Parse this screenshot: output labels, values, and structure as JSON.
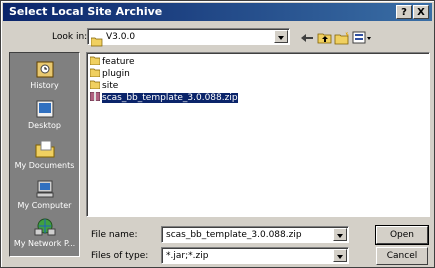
{
  "dialog": {
    "title": "Select Local Site Archive",
    "help_label": "?",
    "close_label": "X"
  },
  "lookin": {
    "label": "Look in:",
    "value": "V3.0.0"
  },
  "places": [
    {
      "label": "History",
      "icon": "history-icon"
    },
    {
      "label": "Desktop",
      "icon": "desktop-icon"
    },
    {
      "label": "My Documents",
      "icon": "my-documents-icon"
    },
    {
      "label": "My Computer",
      "icon": "my-computer-icon"
    },
    {
      "label": "My Network P...",
      "icon": "my-network-places-icon"
    }
  ],
  "files": [
    {
      "name": "feature",
      "type": "folder"
    },
    {
      "name": "plugin",
      "type": "folder"
    },
    {
      "name": "site",
      "type": "folder"
    },
    {
      "name": "scas_bb_template_3.0.088.zip",
      "type": "zip",
      "selected": true
    }
  ],
  "filename": {
    "label": "File name:",
    "value": "scas_bb_template_3.0.088.zip"
  },
  "filetype": {
    "label": "Files of type:",
    "value": "*.jar;*.zip"
  },
  "buttons": {
    "open": "Open",
    "cancel": "Cancel"
  },
  "colors": {
    "titlebar": "#0a246a",
    "selection": "#0a246a",
    "face": "#d4d0c8",
    "places_bg": "#808080"
  }
}
